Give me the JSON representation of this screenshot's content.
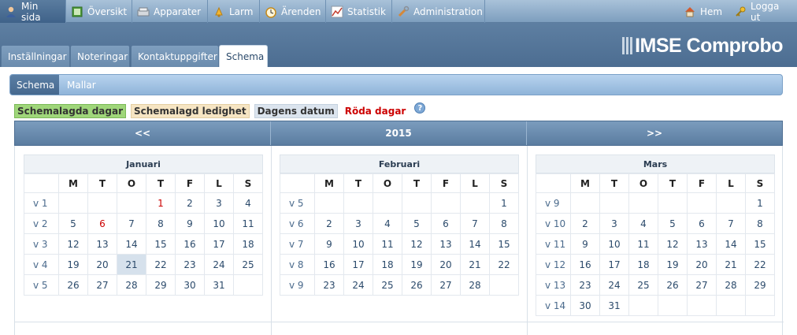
{
  "topnav": {
    "items": [
      {
        "label": "Min sida",
        "icon": "user-icon"
      },
      {
        "label": "Översikt",
        "icon": "overview-icon"
      },
      {
        "label": "Apparater",
        "icon": "devices-icon"
      },
      {
        "label": "Larm",
        "icon": "alarm-icon"
      },
      {
        "label": "Ärenden",
        "icon": "clock-icon"
      },
      {
        "label": "Statistik",
        "icon": "statistics-icon"
      },
      {
        "label": "Administration",
        "icon": "tools-icon"
      }
    ],
    "right": [
      {
        "label": "Hem",
        "icon": "home-icon"
      },
      {
        "label": "Logga ut",
        "icon": "key-icon"
      }
    ]
  },
  "logo": {
    "text": "IMSE Comprobo"
  },
  "subtabs": [
    "Inställningar",
    "Noteringar",
    "Kontaktuppgifter",
    "Schema"
  ],
  "bar2": [
    "Schema",
    "Mallar"
  ],
  "legend": {
    "scheduled": "Schemalagda dagar",
    "leave": "Schemalagd ledighet",
    "today": "Dagens datum",
    "red": "Röda dagar"
  },
  "calhead": {
    "prev": "<<",
    "year": "2015",
    "next": ">>"
  },
  "weekdays": [
    "M",
    "T",
    "O",
    "T",
    "F",
    "L",
    "S"
  ],
  "months": [
    {
      "name": "Januari",
      "weeks": [
        {
          "wk": "v 1",
          "days": [
            "",
            "",
            "",
            "1",
            "2",
            "3",
            "4"
          ]
        },
        {
          "wk": "v 2",
          "days": [
            "5",
            "6",
            "7",
            "8",
            "9",
            "10",
            "11"
          ]
        },
        {
          "wk": "v 3",
          "days": [
            "12",
            "13",
            "14",
            "15",
            "16",
            "17",
            "18"
          ]
        },
        {
          "wk": "v 4",
          "days": [
            "19",
            "20",
            "21",
            "22",
            "23",
            "24",
            "25"
          ]
        },
        {
          "wk": "v 5",
          "days": [
            "26",
            "27",
            "28",
            "29",
            "30",
            "31",
            ""
          ]
        }
      ]
    },
    {
      "name": "Februari",
      "weeks": [
        {
          "wk": "v 5",
          "days": [
            "",
            "",
            "",
            "",
            "",
            "",
            "1"
          ]
        },
        {
          "wk": "v 6",
          "days": [
            "2",
            "3",
            "4",
            "5",
            "6",
            "7",
            "8"
          ]
        },
        {
          "wk": "v 7",
          "days": [
            "9",
            "10",
            "11",
            "12",
            "13",
            "14",
            "15"
          ]
        },
        {
          "wk": "v 8",
          "days": [
            "16",
            "17",
            "18",
            "19",
            "20",
            "21",
            "22"
          ]
        },
        {
          "wk": "v 9",
          "days": [
            "23",
            "24",
            "25",
            "26",
            "27",
            "28",
            ""
          ]
        }
      ]
    },
    {
      "name": "Mars",
      "weeks": [
        {
          "wk": "v 9",
          "days": [
            "",
            "",
            "",
            "",
            "",
            "",
            "1"
          ]
        },
        {
          "wk": "v 10",
          "days": [
            "2",
            "3",
            "4",
            "5",
            "6",
            "7",
            "8"
          ]
        },
        {
          "wk": "v 11",
          "days": [
            "9",
            "10",
            "11",
            "12",
            "13",
            "14",
            "15"
          ]
        },
        {
          "wk": "v 12",
          "days": [
            "16",
            "17",
            "18",
            "19",
            "20",
            "21",
            "22"
          ]
        },
        {
          "wk": "v 13",
          "days": [
            "23",
            "24",
            "25",
            "26",
            "27",
            "28",
            "29"
          ]
        },
        {
          "wk": "v 14",
          "days": [
            "30",
            "31",
            "",
            "",
            "",
            "",
            ""
          ]
        }
      ]
    }
  ],
  "red_days": {
    "Januari": [
      "1",
      "6"
    ]
  },
  "today": {
    "month": "Januari",
    "day": "21"
  },
  "colors": {
    "red_day": "#cc0000",
    "scheduled": "#9fd67a",
    "leave": "#f6e5c3",
    "today": "#d6e1ec"
  }
}
